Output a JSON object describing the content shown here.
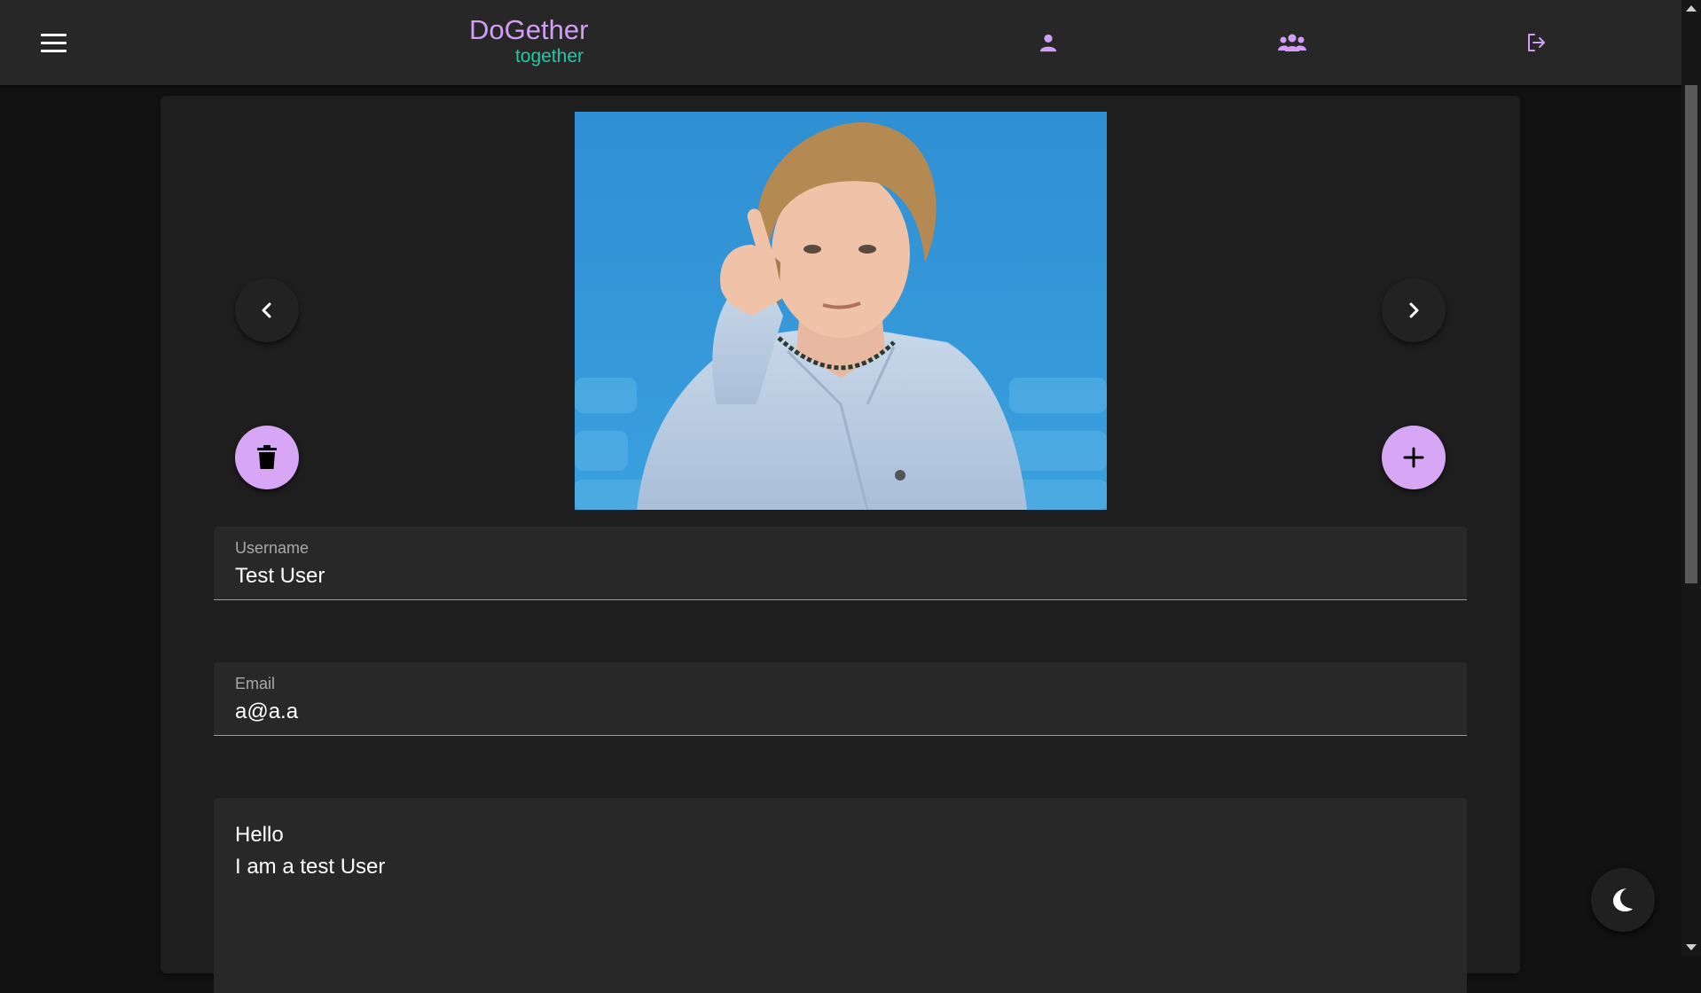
{
  "app": {
    "title": "DoGether",
    "subtitle": "together"
  },
  "nav": {
    "icons": [
      "menu-icon",
      "person-icon",
      "group-icon",
      "logout-icon"
    ]
  },
  "profile": {
    "photo_alt": "Profile photo",
    "username_label": "Username",
    "username_value": "Test User",
    "email_label": "Email",
    "email_value": "a@a.a",
    "bio_lines": [
      "Hello",
      "I am a test User"
    ]
  },
  "colors": {
    "accent": "#d7a6f4",
    "brand_title": "#d39cf5",
    "brand_subtitle": "#1fc9a6",
    "background": "#121212",
    "card": "#1e1e1e"
  }
}
